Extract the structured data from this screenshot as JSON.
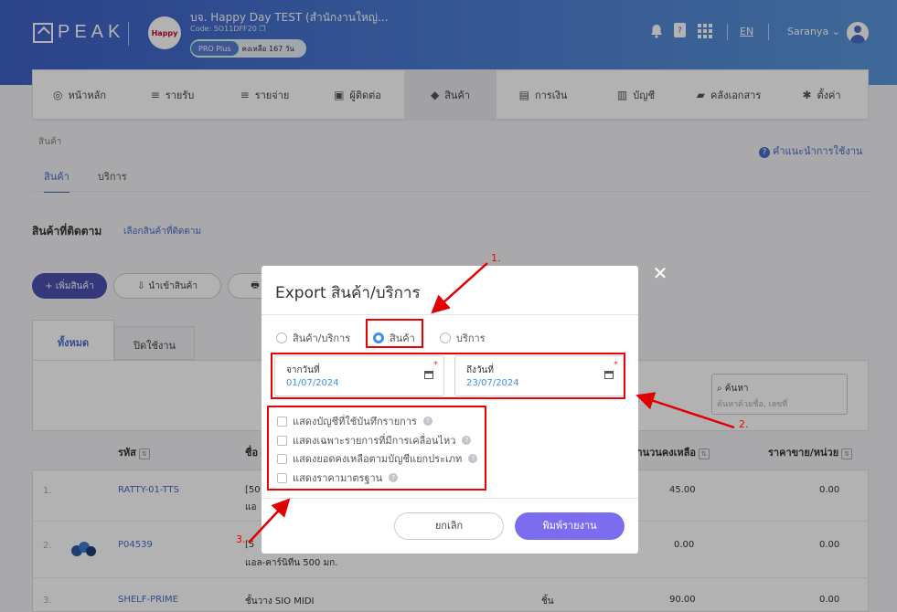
{
  "header": {
    "logo_text": "PEAK",
    "company_logo_text": "Happy",
    "company_name": "บจ. Happy Day TEST (สำนักงานใหญ่...",
    "company_code": "Code: 5O11DFF20",
    "plan_badge": "PRO Plus",
    "remaining": "คงเหลือ 167 วัน",
    "language": "EN",
    "username": "Saranya",
    "icons": [
      "bell-icon",
      "doc-icon",
      "apps-grid-icon"
    ]
  },
  "nav": {
    "items": [
      {
        "label": "หน้าหลัก",
        "icon": "◎"
      },
      {
        "label": "รายรับ",
        "icon": "≡"
      },
      {
        "label": "รายจ่าย",
        "icon": "≡"
      },
      {
        "label": "ผู้ติดต่อ",
        "icon": "▣"
      },
      {
        "label": "สินค้า",
        "icon": "◆"
      },
      {
        "label": "การเงิน",
        "icon": "▤"
      },
      {
        "label": "บัญชี",
        "icon": "▥"
      },
      {
        "label": "คลังเอกสาร",
        "icon": "▰"
      },
      {
        "label": "ตั้งค่า",
        "icon": "✱"
      }
    ]
  },
  "page": {
    "breadcrumb": "สินค้า",
    "help_link": "คำแนะนำการใช้งาน",
    "subtabs": [
      "สินค้า",
      "บริการ"
    ],
    "tracked_title": "สินค้าที่ติดตาม",
    "tracked_link": "เลือกสินค้าที่ติดตาม",
    "add_button": "+ เพิ่มสินค้า",
    "import_button": "นำเข้าสินค้า",
    "print_button_icon": "🖶",
    "tab_all": "ทั้งหมด",
    "tab_closed": "ปิดใช้งาน",
    "search_label": "ค้นหา",
    "search_placeholder": "ค้นหาด้วยชื่อ, เลขที่",
    "columns": {
      "code": "รหัส",
      "name": "ชื่อ",
      "remaining": "จำนวนคงเหลือ",
      "price": "ราคาขาย/หน่วย"
    },
    "rows": [
      {
        "no": "1.",
        "code": "RATTY-01-TTS",
        "name1": "[50",
        "name2": "แอ",
        "unit": "",
        "qty": "45.00",
        "price": "0.00"
      },
      {
        "no": "2.",
        "code": "P04539",
        "name1": "[5",
        "name2": "แอล-คาร์นิทีน 500 มก.",
        "unit": "",
        "qty": "0.00",
        "price": "0.00"
      },
      {
        "no": "3.",
        "code": "SHELF-PRIME",
        "name1": "ชั้นวาง SIO MIDI",
        "name2": "",
        "unit": "ชิ้น",
        "qty": "90.00",
        "price": "0.00"
      }
    ]
  },
  "modal": {
    "title": "Export สินค้า/บริการ",
    "radios": [
      {
        "label": "สินค้า/บริการ",
        "selected": false
      },
      {
        "label": "สินค้า",
        "selected": true
      },
      {
        "label": "บริการ",
        "selected": false
      }
    ],
    "from_label": "จากวันที่",
    "from_value": "01/07/2024",
    "to_label": "ถึงวันที่",
    "to_value": "23/07/2024",
    "required_mark": "*",
    "checkboxes": [
      "แสดงบัญชีที่ใช้บันทึกรายการ",
      "แสดงเฉพาะรายการที่มีการเคลื่อนไหว",
      "แสดงยอดคงเหลือตามบัญชีแยกประเภท",
      "แสดงราคามาตรฐาน"
    ],
    "cancel_button": "ยกเลิก",
    "print_button": "พิมพ์รายงาน",
    "close_symbol": "✕"
  },
  "annotations": {
    "one": "1.",
    "two": "2.",
    "three": "3.",
    "color": "#e00000"
  }
}
